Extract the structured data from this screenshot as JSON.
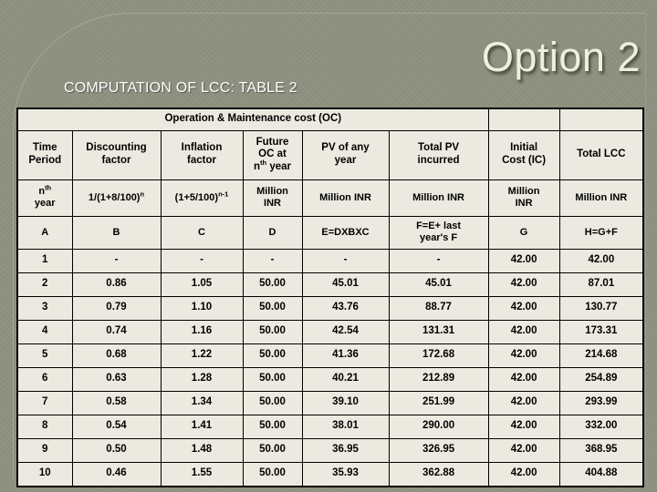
{
  "slide": {
    "option_title": "Option 2",
    "heading": "COMPUTATION OF LCC: TABLE 2",
    "background_color": "#8c8f7e",
    "title_color": "#eef0dc",
    "accent_color": "#1c62c9",
    "cell_background": "#eceae0"
  },
  "table": {
    "group_header": {
      "oc_label": "Operation & Maintenance cost (OC)"
    },
    "columns": [
      {
        "label_line1": "Time",
        "label_line2": "Period",
        "unit_line1": "n",
        "unit_sup": "th",
        "unit_line2": "year",
        "letter": "A",
        "blue_header": true,
        "blue_unit": true
      },
      {
        "label_line1": "Discounting",
        "label_line2": "factor",
        "unit_line1": "1/(1+8/100)",
        "unit_sup": "n",
        "unit_line2": "",
        "letter": "B",
        "blue_header": false,
        "blue_unit": false
      },
      {
        "label_line1": "Inflation",
        "label_line2": "factor",
        "unit_line1": "(1+5/100)",
        "unit_sup": "n-1",
        "unit_line2": "",
        "letter": "C",
        "blue_header": false,
        "blue_unit": false
      },
      {
        "label_line1": "Future",
        "label_line15": "OC at",
        "label_line2": "n",
        "label_sup": "th",
        "label_line2b": " year",
        "unit_line1": "Million",
        "unit_line2": "INR",
        "letter": "D",
        "blue_header": false,
        "blue_unit": false
      },
      {
        "label_line1": "PV of any",
        "label_line2": "year",
        "unit_line1": "Million INR",
        "unit_line2": "",
        "letter": "E=DXBXC",
        "blue_header": false,
        "blue_unit": false
      },
      {
        "label_line1": "Total PV",
        "label_line2": "incurred",
        "unit_line1": "Million INR",
        "unit_line2": "",
        "letter_line1": "F=E+ last",
        "letter_line2": "year's F",
        "blue_header": false,
        "blue_unit": false
      },
      {
        "label_line1": "Initial",
        "label_line2": "Cost (IC)",
        "unit_line1": "Million",
        "unit_line2": "INR",
        "letter": "G",
        "blue_header": true,
        "blue_unit": false
      },
      {
        "label_line1": "Total LCC",
        "label_line2": "",
        "unit_line1": "Million INR",
        "unit_line2": "",
        "letter": "H=G+F",
        "blue_header": true,
        "blue_unit": false
      }
    ],
    "rows": [
      {
        "time_period": "1",
        "discounting_factor": "-",
        "inflation_factor": "-",
        "future_oc": "-",
        "pv_of_any_year": "-",
        "total_pv_incurred": "-",
        "initial_cost": "42.00",
        "total_lcc": "42.00"
      },
      {
        "time_period": "2",
        "discounting_factor": "0.86",
        "inflation_factor": "1.05",
        "future_oc": "50.00",
        "pv_of_any_year": "45.01",
        "total_pv_incurred": "45.01",
        "initial_cost": "42.00",
        "total_lcc": "87.01"
      },
      {
        "time_period": "3",
        "discounting_factor": "0.79",
        "inflation_factor": "1.10",
        "future_oc": "50.00",
        "pv_of_any_year": "43.76",
        "total_pv_incurred": "88.77",
        "initial_cost": "42.00",
        "total_lcc": "130.77"
      },
      {
        "time_period": "4",
        "discounting_factor": "0.74",
        "inflation_factor": "1.16",
        "future_oc": "50.00",
        "pv_of_any_year": "42.54",
        "total_pv_incurred": "131.31",
        "initial_cost": "42.00",
        "total_lcc": "173.31"
      },
      {
        "time_period": "5",
        "discounting_factor": "0.68",
        "inflation_factor": "1.22",
        "future_oc": "50.00",
        "pv_of_any_year": "41.36",
        "total_pv_incurred": "172.68",
        "initial_cost": "42.00",
        "total_lcc": "214.68"
      },
      {
        "time_period": "6",
        "discounting_factor": "0.63",
        "inflation_factor": "1.28",
        "future_oc": "50.00",
        "pv_of_any_year": "40.21",
        "total_pv_incurred": "212.89",
        "initial_cost": "42.00",
        "total_lcc": "254.89"
      },
      {
        "time_period": "7",
        "discounting_factor": "0.58",
        "inflation_factor": "1.34",
        "future_oc": "50.00",
        "pv_of_any_year": "39.10",
        "total_pv_incurred": "251.99",
        "initial_cost": "42.00",
        "total_lcc": "293.99"
      },
      {
        "time_period": "8",
        "discounting_factor": "0.54",
        "inflation_factor": "1.41",
        "future_oc": "50.00",
        "pv_of_any_year": "38.01",
        "total_pv_incurred": "290.00",
        "initial_cost": "42.00",
        "total_lcc": "332.00"
      },
      {
        "time_period": "9",
        "discounting_factor": "0.50",
        "inflation_factor": "1.48",
        "future_oc": "50.00",
        "pv_of_any_year": "36.95",
        "total_pv_incurred": "326.95",
        "initial_cost": "42.00",
        "total_lcc": "368.95"
      },
      {
        "time_period": "10",
        "discounting_factor": "0.46",
        "inflation_factor": "1.55",
        "future_oc": "50.00",
        "pv_of_any_year": "35.93",
        "total_pv_incurred": "362.88",
        "initial_cost": "42.00",
        "total_lcc": "404.88"
      }
    ]
  }
}
